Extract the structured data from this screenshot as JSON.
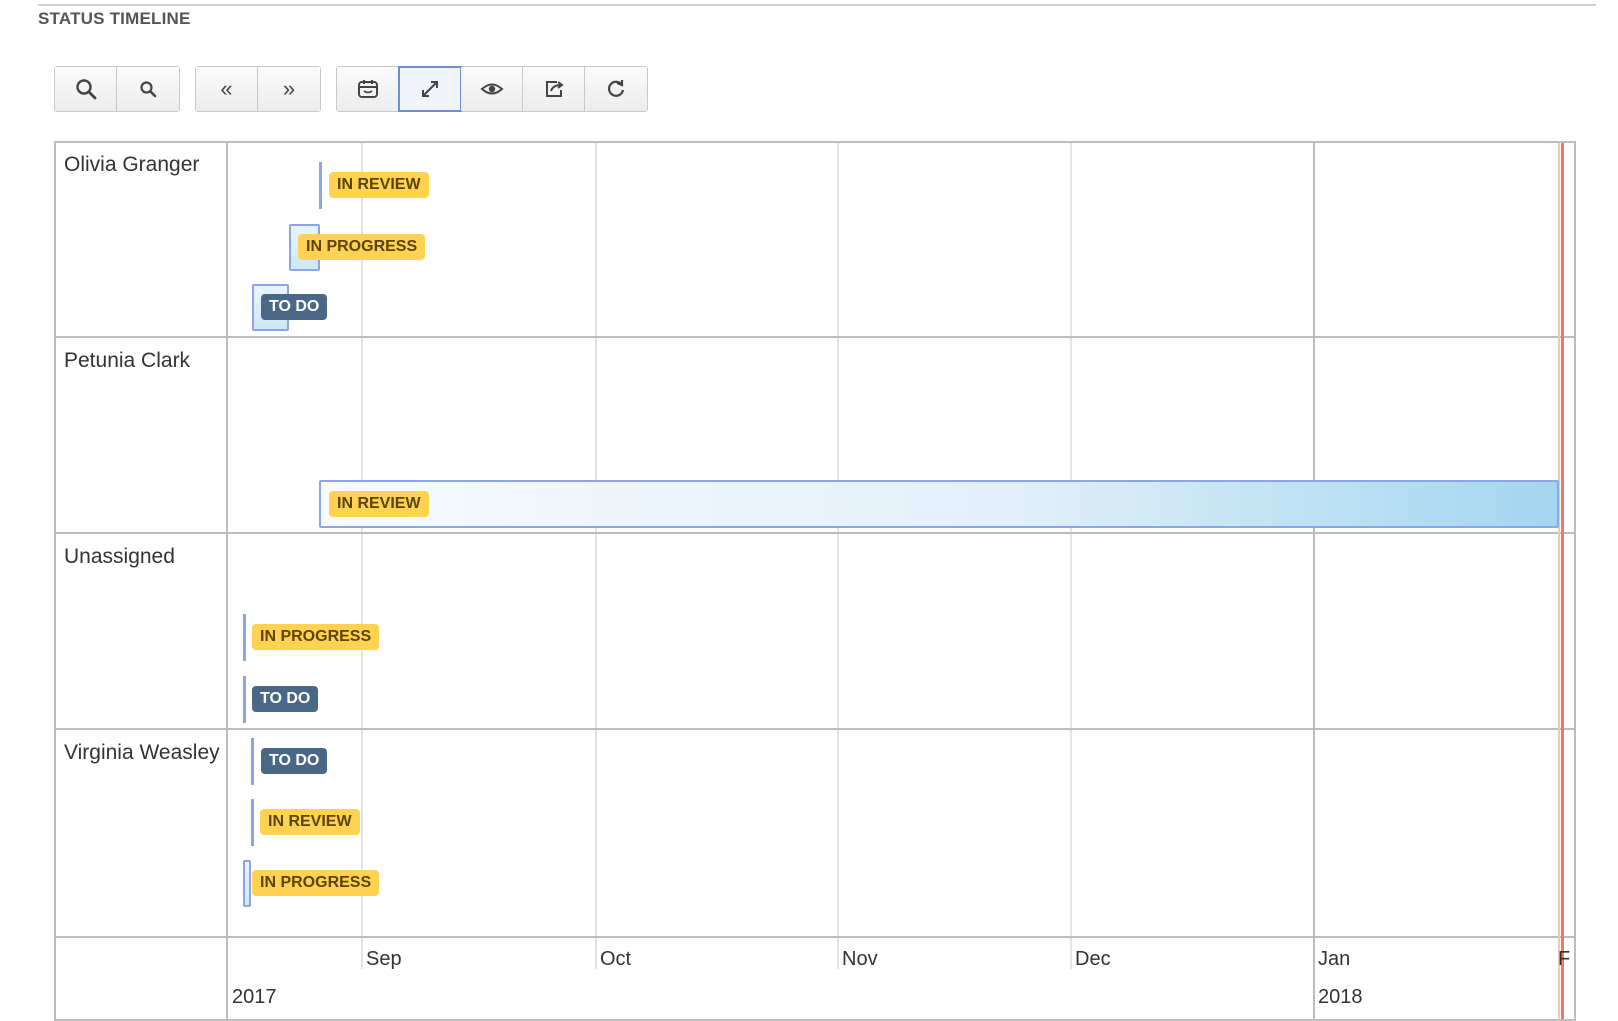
{
  "section": {
    "title": "STATUS TIMELINE"
  },
  "toolbar": {
    "zoom_in_icon": "zoom-in-icon",
    "zoom_out_icon": "zoom-out-icon",
    "prev_label": "«",
    "next_label": "»",
    "today_icon": "calendar-icon",
    "fit_icon": "expand-icon",
    "view_icon": "eye-icon",
    "share_icon": "share-icon",
    "refresh_icon": "refresh-icon",
    "active_button": "fit"
  },
  "timeline": {
    "rows": [
      {
        "label": "Olivia Granger",
        "items": [
          {
            "status": "IN REVIEW"
          },
          {
            "status": "IN PROGRESS"
          },
          {
            "status": "TO DO"
          }
        ]
      },
      {
        "label": "Petunia Clark",
        "items": [
          {
            "status": "IN REVIEW"
          }
        ]
      },
      {
        "label": "Unassigned",
        "items": [
          {
            "status": "IN PROGRESS"
          },
          {
            "status": "TO DO"
          }
        ]
      },
      {
        "label": "Virginia Weasley",
        "items": [
          {
            "status": "TO DO"
          },
          {
            "status": "IN REVIEW"
          },
          {
            "status": "IN PROGRESS"
          }
        ]
      }
    ],
    "axis": {
      "months": [
        "Sep",
        "Oct",
        "Nov",
        "Dec",
        "Jan",
        "F"
      ],
      "years": [
        "2017",
        "2018"
      ]
    },
    "colors": {
      "review": "#ffd351",
      "progress": "#ffd351",
      "todo": "#4a6785",
      "item_border": "#8aa6e6",
      "now_line": "#f07a63"
    }
  }
}
